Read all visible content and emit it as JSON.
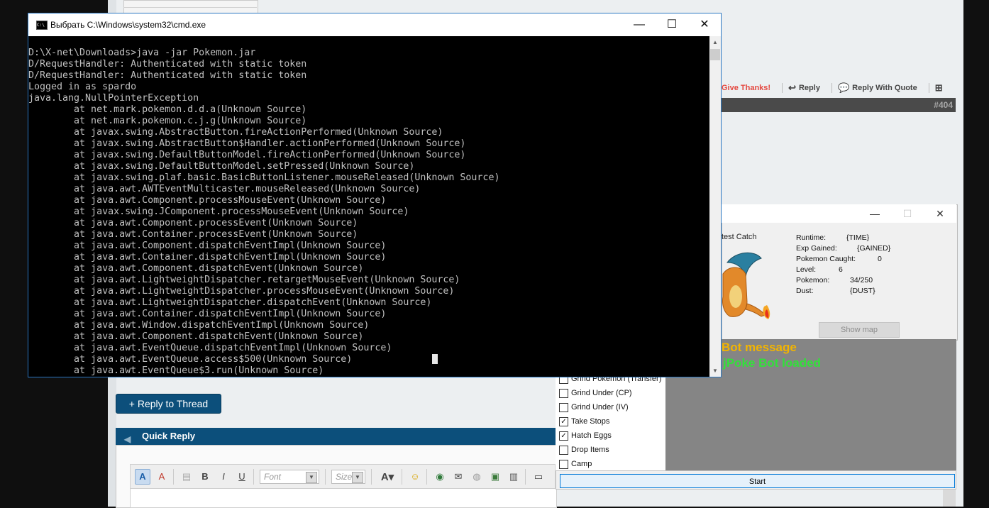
{
  "cmd": {
    "title": "Выбрать C:\\Windows\\system32\\cmd.exe",
    "icon": "cmd-icon",
    "buttons": {
      "minimize": "—",
      "maximize": "☐",
      "close": "✕"
    },
    "lines": [
      "D:\\X-net\\Downloads>java -jar Pokemon.jar",
      "D/RequestHandler: Authenticated with static token",
      "D/RequestHandler: Authenticated with static token",
      "Logged in as spardo",
      "java.lang.NullPointerException",
      "        at net.mark.pokemon.d.d.a(Unknown Source)",
      "        at net.mark.pokemon.c.j.g(Unknown Source)",
      "        at javax.swing.AbstractButton.fireActionPerformed(Unknown Source)",
      "        at javax.swing.AbstractButton$Handler.actionPerformed(Unknown Source)",
      "        at javax.swing.DefaultButtonModel.fireActionPerformed(Unknown Source)",
      "        at javax.swing.DefaultButtonModel.setPressed(Unknown Source)",
      "        at javax.swing.plaf.basic.BasicButtonListener.mouseReleased(Unknown Source)",
      "        at java.awt.AWTEventMulticaster.mouseReleased(Unknown Source)",
      "        at java.awt.Component.processMouseEvent(Unknown Source)",
      "        at javax.swing.JComponent.processMouseEvent(Unknown Source)",
      "        at java.awt.Component.processEvent(Unknown Source)",
      "        at java.awt.Container.processEvent(Unknown Source)",
      "        at java.awt.Component.dispatchEventImpl(Unknown Source)",
      "        at java.awt.Container.dispatchEventImpl(Unknown Source)",
      "        at java.awt.Component.dispatchEvent(Unknown Source)",
      "        at java.awt.LightweightDispatcher.retargetMouseEvent(Unknown Source)",
      "        at java.awt.LightweightDispatcher.processMouseEvent(Unknown Source)",
      "        at java.awt.LightweightDispatcher.dispatchEvent(Unknown Source)",
      "        at java.awt.Container.dispatchEventImpl(Unknown Source)",
      "        at java.awt.Window.dispatchEventImpl(Unknown Source)",
      "        at java.awt.Component.dispatchEvent(Unknown Source)",
      "        at java.awt.EventQueue.dispatchEventImpl(Unknown Source)",
      "        at java.awt.EventQueue.access$500(Unknown Source)",
      "        at java.awt.EventQueue$3.run(Unknown Source)"
    ]
  },
  "forum": {
    "post_actions": {
      "thanks": "Give Thanks!",
      "reply": "Reply",
      "reply_with_quote": "Reply With Quote"
    },
    "post_number": "#404",
    "reply_to_thread": "+ Reply to Thread",
    "quick_reply": "Quick Reply",
    "editor": {
      "font_placeholder": "Font",
      "size_placeholder": "Size",
      "buttons": [
        "toggle-wysiwyg-icon",
        "remove-format-icon",
        "paste-icon",
        "bold-icon",
        "italic-icon",
        "underline-icon",
        "font-color-icon",
        "smiley-icon",
        "link-icon",
        "email-icon",
        "unlink-icon",
        "image-icon",
        "video-icon",
        "quote-icon"
      ]
    }
  },
  "bot": {
    "buttons": {
      "minimize": "—",
      "maximize": "☐",
      "close": "✕"
    },
    "image_label": "test Catch",
    "stats": [
      {
        "label": "Runtime:",
        "value": "{TIME}"
      },
      {
        "label": "Exp Gained:",
        "value": "{GAINED}"
      },
      {
        "label": "Pokemon Caught:",
        "value": "0"
      },
      {
        "label": "Level:",
        "value": "6"
      },
      {
        "label": "Pokemon:",
        "value": "34/250"
      },
      {
        "label": "Dust:",
        "value": "{DUST}"
      }
    ],
    "show_map": "Show map",
    "message_title": "Bot message",
    "message_text": "jPoke Bot loaded",
    "options": [
      {
        "label": "Grind Pokemon (Transfer)",
        "checked": false
      },
      {
        "label": "Grind Under (CP)",
        "checked": false
      },
      {
        "label": "Grind Under (IV)",
        "checked": false
      },
      {
        "label": "Take Stops",
        "checked": true
      },
      {
        "label": "Hatch Eggs",
        "checked": true
      },
      {
        "label": "Drop Items",
        "checked": false
      },
      {
        "label": "Camp",
        "checked": false
      }
    ],
    "start": "Start"
  },
  "colors": {
    "cmd_bg": "#000000",
    "cmd_text": "#c0c0c0",
    "forum_blue": "#0c4f7b",
    "message_title": "#f2b400",
    "message_text": "#32e03a"
  }
}
